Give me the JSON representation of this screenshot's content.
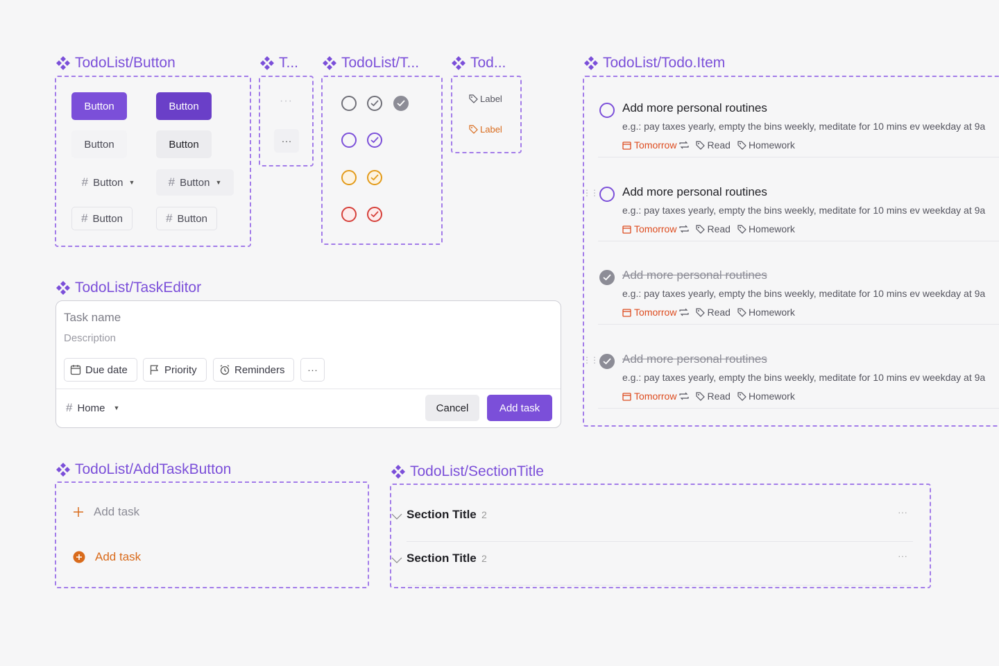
{
  "colors": {
    "accent": "#7b4fd9",
    "due": "#dd4b1e",
    "warning": "#e39b1a",
    "danger": "#d6403a",
    "addTask": "#d96b1c"
  },
  "titles": {
    "button": "TodoList/Button",
    "t1": "T...",
    "t2": "TodoList/T...",
    "t3": "Tod...",
    "todo_item": "TodoList/Todo.Item",
    "task_editor": "TodoList/TaskEditor",
    "add_task_button": "TodoList/AddTaskButton",
    "section_title": "TodoList/SectionTitle"
  },
  "buttons": {
    "label": "Button",
    "more": "···"
  },
  "labels": {
    "label": "Label"
  },
  "todos": [
    {
      "title": "Add more personal routines",
      "desc": "e.g.: pay taxes yearly, empty the bins weekly, meditate for 10 mins ev weekday at 9a",
      "due": "Tomorrow",
      "tags": [
        "Read",
        "Homework"
      ],
      "done": false
    },
    {
      "title": "Add more personal routines",
      "desc": "e.g.: pay taxes yearly, empty the bins weekly, meditate for 10 mins ev weekday at 9a",
      "due": "Tomorrow",
      "tags": [
        "Read",
        "Homework"
      ],
      "done": false
    },
    {
      "title": "Add more personal routines",
      "desc": "e.g.: pay taxes yearly, empty the bins weekly, meditate for 10 mins ev weekday at 9a",
      "due": "Tomorrow",
      "tags": [
        "Read",
        "Homework"
      ],
      "done": true
    },
    {
      "title": "Add more personal routines",
      "desc": "e.g.: pay taxes yearly, empty the bins weekly, meditate for 10 mins ev weekday at 9a",
      "due": "Tomorrow",
      "tags": [
        "Read",
        "Homework"
      ],
      "done": true
    }
  ],
  "editor": {
    "task_name_placeholder": "Task name",
    "description_placeholder": "Description",
    "due_date": "Due date",
    "priority": "Priority",
    "reminders": "Reminders",
    "more": "···",
    "project": "Home",
    "cancel": "Cancel",
    "add_task": "Add task"
  },
  "add_task": {
    "label": "Add task"
  },
  "sections": [
    {
      "title": "Section Title",
      "count": "2",
      "more": "···"
    },
    {
      "title": "Section Title",
      "count": "2",
      "more": "···"
    }
  ]
}
